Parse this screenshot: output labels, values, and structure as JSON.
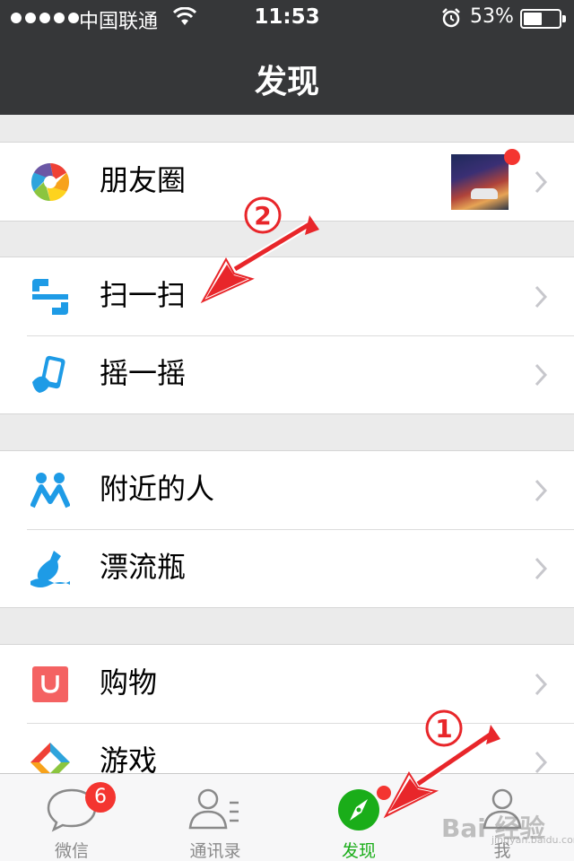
{
  "status_bar": {
    "carrier": "中国联通",
    "time": "11:53",
    "battery": "53%",
    "battery_level": 0.53
  },
  "nav": {
    "title": "发现"
  },
  "groups": [
    {
      "items": [
        {
          "label": "朋友圈",
          "icon": "moments-icon",
          "has_thumbnail": true,
          "has_dot": true
        }
      ]
    },
    {
      "items": [
        {
          "label": "扫一扫",
          "icon": "scan-icon"
        },
        {
          "label": "摇一摇",
          "icon": "shake-icon"
        }
      ]
    },
    {
      "items": [
        {
          "label": "附近的人",
          "icon": "people-nearby-icon"
        },
        {
          "label": "漂流瓶",
          "icon": "drift-bottle-icon"
        }
      ]
    },
    {
      "items": [
        {
          "label": "购物",
          "icon": "shopping-icon"
        },
        {
          "label": "游戏",
          "icon": "games-icon"
        }
      ]
    }
  ],
  "tabbar": {
    "tabs": [
      {
        "label": "微信",
        "icon": "chat-icon",
        "badge": "6"
      },
      {
        "label": "通讯录",
        "icon": "contacts-icon"
      },
      {
        "label": "发现",
        "icon": "discover-icon",
        "active": true,
        "dot": true
      },
      {
        "label": "我",
        "icon": "me-icon"
      }
    ]
  },
  "annotations": {
    "step_1": "①",
    "step_2": "②"
  },
  "watermark": {
    "text": "Bai 经验",
    "sub": "jingyan.baidu.com"
  },
  "colors": {
    "nav_bg": "#363739",
    "accent": "#1aad19",
    "badge": "#f43530",
    "annotation": "#e8262a",
    "icon_blue": "#1296db"
  }
}
